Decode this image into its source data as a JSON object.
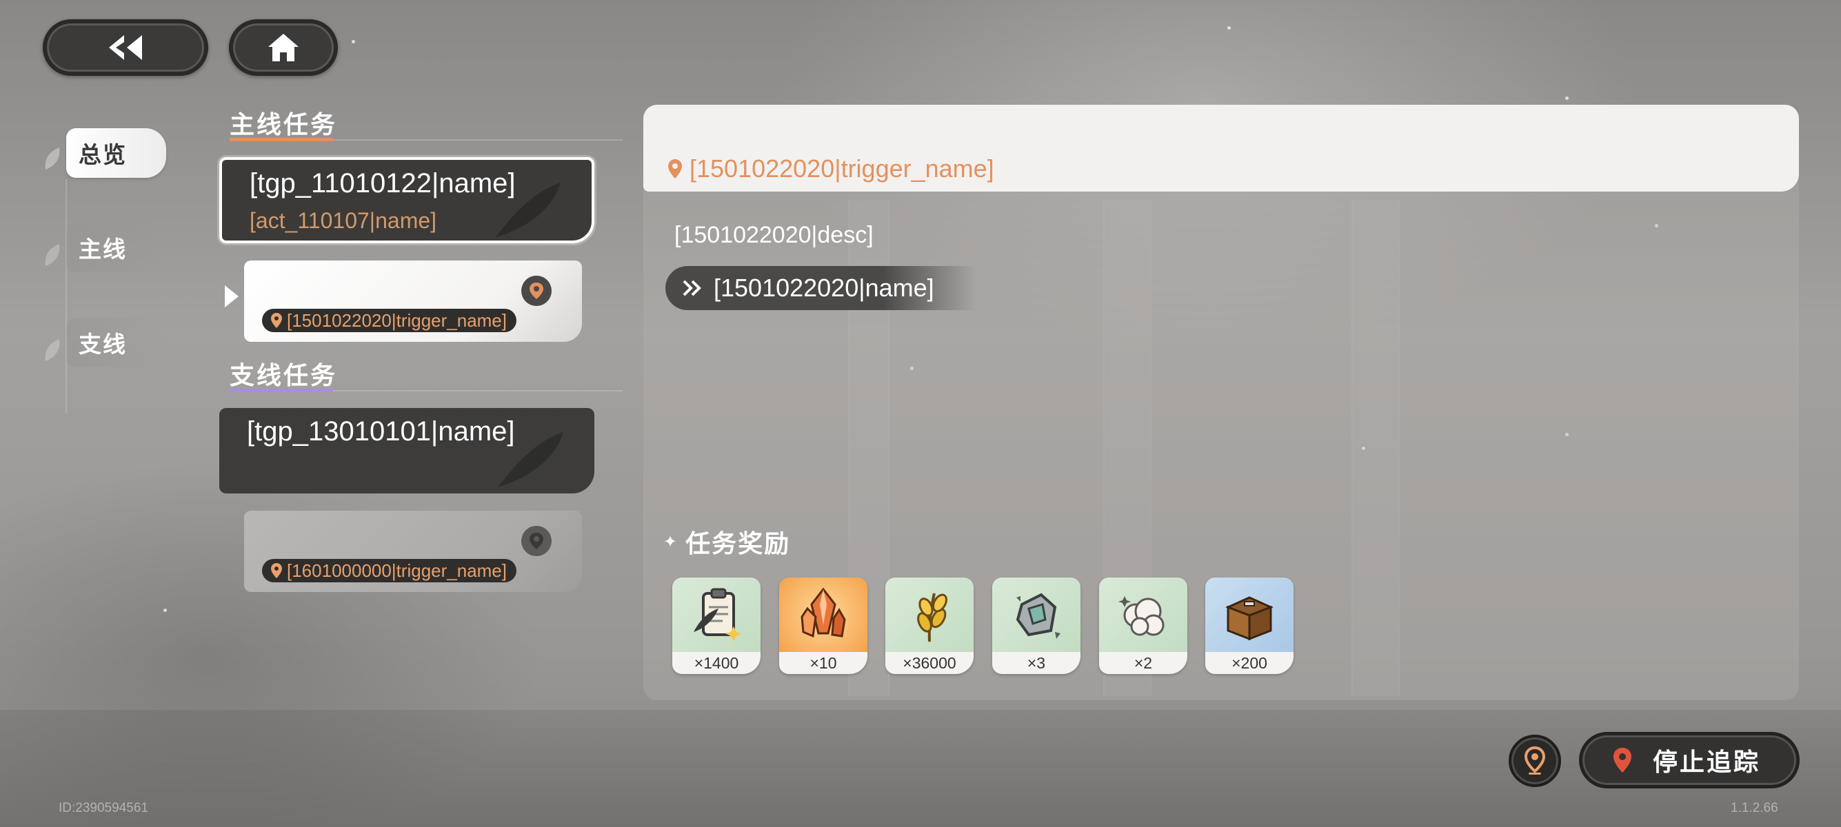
{
  "header": {
    "back_icon": "double-chevron-left-icon",
    "home_icon": "home-icon"
  },
  "category_tabs": [
    {
      "label": "总览",
      "active": true
    },
    {
      "label": "主线",
      "active": false
    },
    {
      "label": "支线",
      "active": false
    }
  ],
  "main_quests": {
    "title": "主线任务",
    "underline_color": "#e3915e",
    "quest": {
      "title": "[tgp_11010122|name]",
      "subtitle": "[act_110107|name]"
    },
    "trigger": "[1501022020|trigger_name]"
  },
  "side_quests": {
    "title": "支线任务",
    "underline_color": "#a88ce6",
    "quest": {
      "title": "[tgp_13010101|name]"
    },
    "trigger": "[1601000000|trigger_name]"
  },
  "detail": {
    "trigger": "[1501022020|trigger_name]",
    "desc": "[1501022020|desc]",
    "step": "[1501022020|name]",
    "rewards_title": "任务奖励",
    "rewards": [
      {
        "icon": "clipboard-quill-icon",
        "count": "×1400",
        "bg": "green"
      },
      {
        "icon": "crystal-cluster-icon",
        "count": "×10",
        "bg": "orange"
      },
      {
        "icon": "golden-wheat-icon",
        "count": "×36000",
        "bg": "green"
      },
      {
        "icon": "ore-stone-icon",
        "count": "×3",
        "bg": "green"
      },
      {
        "icon": "cotton-cloud-icon",
        "count": "×2",
        "bg": "green"
      },
      {
        "icon": "wooden-chest-icon",
        "count": "×200",
        "bg": "blue"
      }
    ]
  },
  "actions": {
    "stop_tracking_label": "停止追踪",
    "map_pin_icon": "map-pin-icon"
  },
  "footer": {
    "id": "ID:2390594561",
    "version": "1.1.2.66"
  }
}
